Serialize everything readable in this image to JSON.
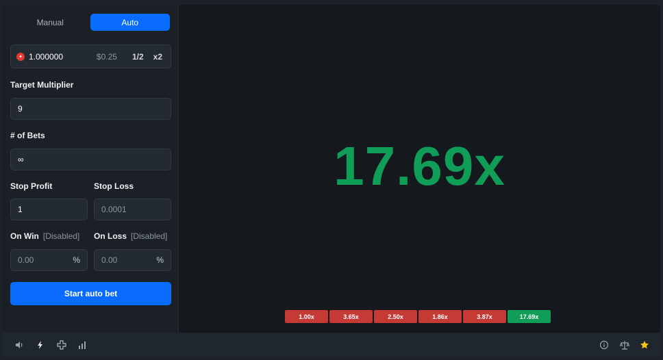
{
  "tabs": {
    "manual": "Manual",
    "auto": "Auto",
    "active": "Auto"
  },
  "bet": {
    "amount": "1.000000",
    "usd": "$0.25",
    "half_label": "1/2",
    "double_label": "x2",
    "coin_icon": "red-coin-icon"
  },
  "target_multiplier": {
    "label": "Target Multiplier",
    "value": "9"
  },
  "num_bets": {
    "label": "# of Bets",
    "value": "∞"
  },
  "stop_profit": {
    "label": "Stop Profit",
    "value": "1"
  },
  "stop_loss": {
    "label": "Stop Loss",
    "placeholder": "0.0001"
  },
  "on_win": {
    "label": "On Win",
    "status": "[Disabled]",
    "placeholder": "0.00",
    "suffix": "%"
  },
  "on_loss": {
    "label": "On Loss",
    "status": "[Disabled]",
    "placeholder": "0.00",
    "suffix": "%"
  },
  "start_button": "Start auto bet",
  "result": {
    "multiplier": "17.69x",
    "color": "#0f9d58"
  },
  "history": [
    {
      "value": "1.00x",
      "status": "loss"
    },
    {
      "value": "3.65x",
      "status": "loss"
    },
    {
      "value": "2.50x",
      "status": "loss"
    },
    {
      "value": "1.86x",
      "status": "loss"
    },
    {
      "value": "3.87x",
      "status": "loss"
    },
    {
      "value": "17.69x",
      "status": "win"
    }
  ],
  "footer": {
    "left_icons": [
      "volume-icon",
      "lightning-icon",
      "settings-gamepad-icon",
      "stats-icon"
    ],
    "right_icons": [
      "info-icon",
      "fairness-scale-icon",
      "favorite-star-icon"
    ]
  },
  "colors": {
    "accent": "#0a6cff",
    "win": "#0f9d58",
    "loss": "#c53a35"
  }
}
